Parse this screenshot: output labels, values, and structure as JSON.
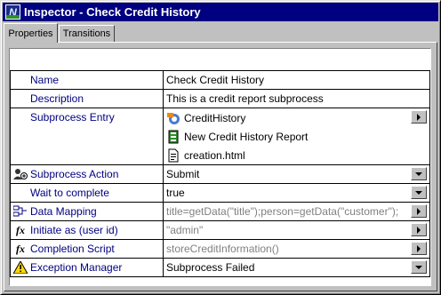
{
  "window": {
    "title": "Inspector - Check Credit History",
    "icon_letter": "N"
  },
  "tabs": [
    {
      "label": "Properties",
      "active": true
    },
    {
      "label": "Transitions",
      "active": false
    }
  ],
  "properties": {
    "name": {
      "label": "Name",
      "value": "Check Credit History"
    },
    "description": {
      "label": "Description",
      "value": "This is a credit report subprocess"
    },
    "subprocess_entry": {
      "label": "Subprocess Entry",
      "items": [
        {
          "icon": "process-icon",
          "text": "CreditHistory"
        },
        {
          "icon": "report-icon",
          "text": "New Credit History Report"
        },
        {
          "icon": "html-file-icon",
          "text": "creation.html"
        }
      ]
    },
    "subprocess_action": {
      "label": "Subprocess Action",
      "value": "Submit",
      "icon": "users-icon"
    },
    "wait_to_complete": {
      "label": "Wait to complete",
      "value": "true"
    },
    "data_mapping": {
      "label": "Data Mapping",
      "value": "title=getData(\"title\");person=getData(\"customer\");",
      "icon": "data-mapping-icon"
    },
    "initiate_as": {
      "label": "Initiate as (user id)",
      "value": "\"admin\"",
      "icon": "fx-icon"
    },
    "completion_script": {
      "label": "Completion Script",
      "value": "storeCreditInformation()",
      "icon": "fx-icon"
    },
    "exception_manager": {
      "label": "Exception Manager",
      "value": "Subprocess Failed",
      "icon": "warning-icon"
    }
  }
}
